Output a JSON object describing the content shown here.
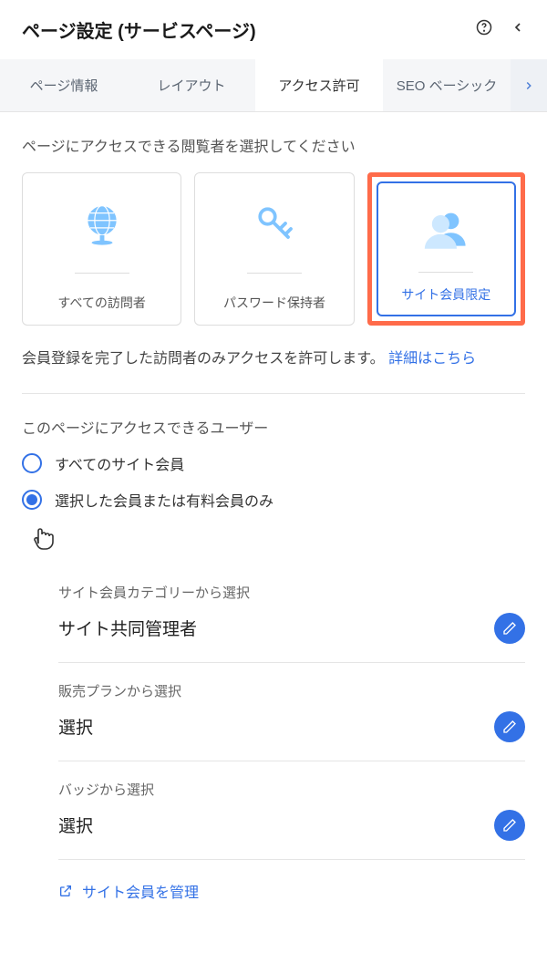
{
  "header": {
    "title": "ページ設定 (サービスページ)"
  },
  "tabs": {
    "items": [
      "ページ情報",
      "レイアウト",
      "アクセス許可",
      "SEO ベーシック"
    ],
    "activeIndex": 2
  },
  "access": {
    "prompt": "ページにアクセスできる閲覧者を選択してください",
    "cards": [
      {
        "label": "すべての訪問者",
        "icon": "globe"
      },
      {
        "label": "パスワード保持者",
        "icon": "key"
      },
      {
        "label": "サイト会員限定",
        "icon": "members"
      }
    ],
    "selected": 2,
    "descPrefix": "会員登録を完了した訪問者のみアクセスを許可します。",
    "descLink": "詳細はこちら"
  },
  "users": {
    "heading": "このページにアクセスできるユーザー",
    "radios": [
      {
        "label": "すべてのサイト会員",
        "checked": false
      },
      {
        "label": "選択した会員または有料会員のみ",
        "checked": true
      }
    ],
    "selectors": [
      {
        "caption": "サイト会員カテゴリーから選択",
        "value": "サイト共同管理者"
      },
      {
        "caption": "販売プランから選択",
        "value": "選択"
      },
      {
        "caption": "バッジから選択",
        "value": "選択"
      }
    ]
  },
  "footer": {
    "manageLink": "サイト会員を管理"
  }
}
